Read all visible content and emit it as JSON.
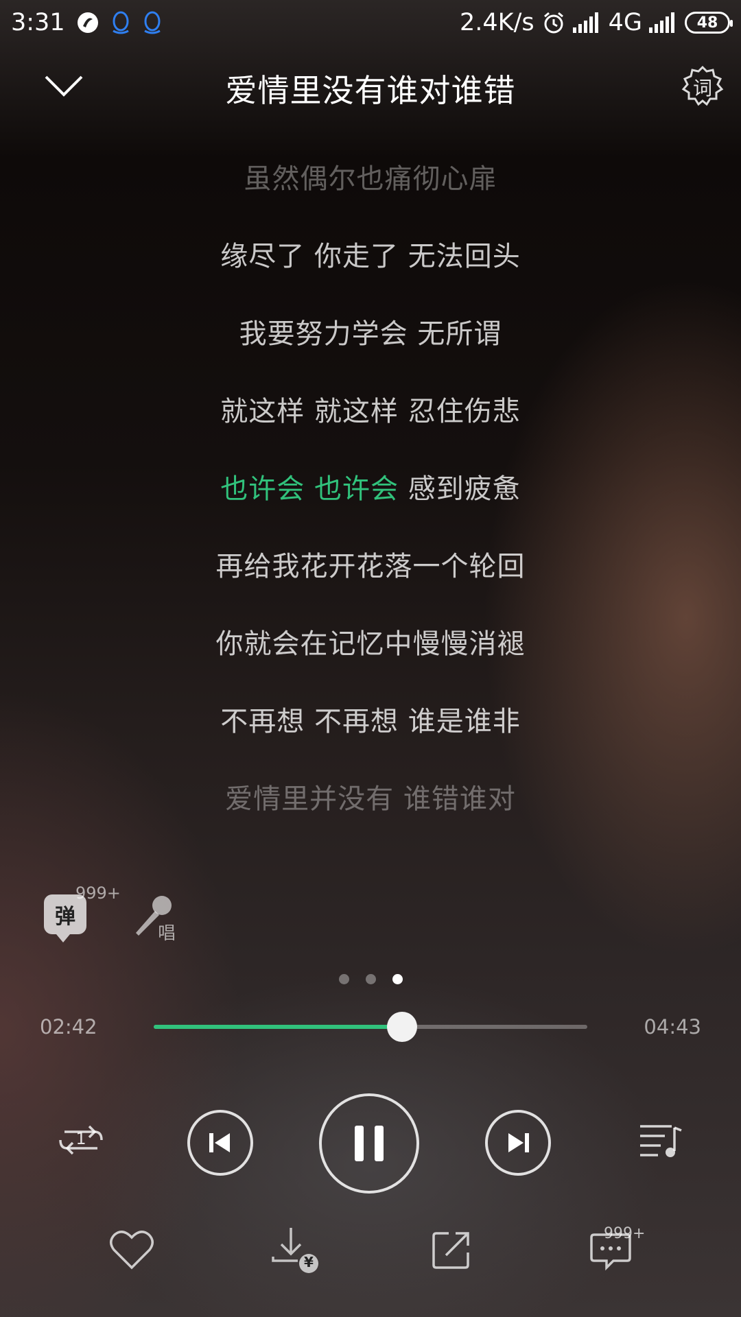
{
  "status_bar": {
    "time": "3:31",
    "net_speed": "2.4K/s",
    "network": "4G",
    "battery": "48",
    "icons": [
      "app-icon",
      "qq-icon",
      "qq-icon",
      "alarm-icon",
      "signal-icon",
      "signal-icon"
    ]
  },
  "header": {
    "title": "爱情里没有谁对谁错",
    "lyric_btn_label": "词"
  },
  "lyrics": {
    "lines": [
      "虽然偶尔也痛彻心扉",
      "缘尽了 你走了 无法回头",
      "我要努力学会 无所谓",
      "就这样 就这样 忍住伤悲",
      "感到疲惫",
      "再给我花开花落一个轮回",
      "你就会在记忆中慢慢消褪",
      "不再想 不再想 谁是谁非",
      "爱情里并没有 谁错谁对"
    ],
    "current_highlight": "也许会 也许会 ",
    "current_index": 4
  },
  "tools": {
    "danmu_label": "弹",
    "danmu_count": "999+",
    "sing_label": "唱"
  },
  "progress": {
    "current": "02:42",
    "total": "04:43",
    "fraction": 0.572,
    "accent": "#31c27c"
  },
  "pager": {
    "count": 3,
    "active": 2
  },
  "loop_mode_label": "1",
  "bottom": {
    "download_badge": "¥",
    "comment_count": "999+"
  }
}
